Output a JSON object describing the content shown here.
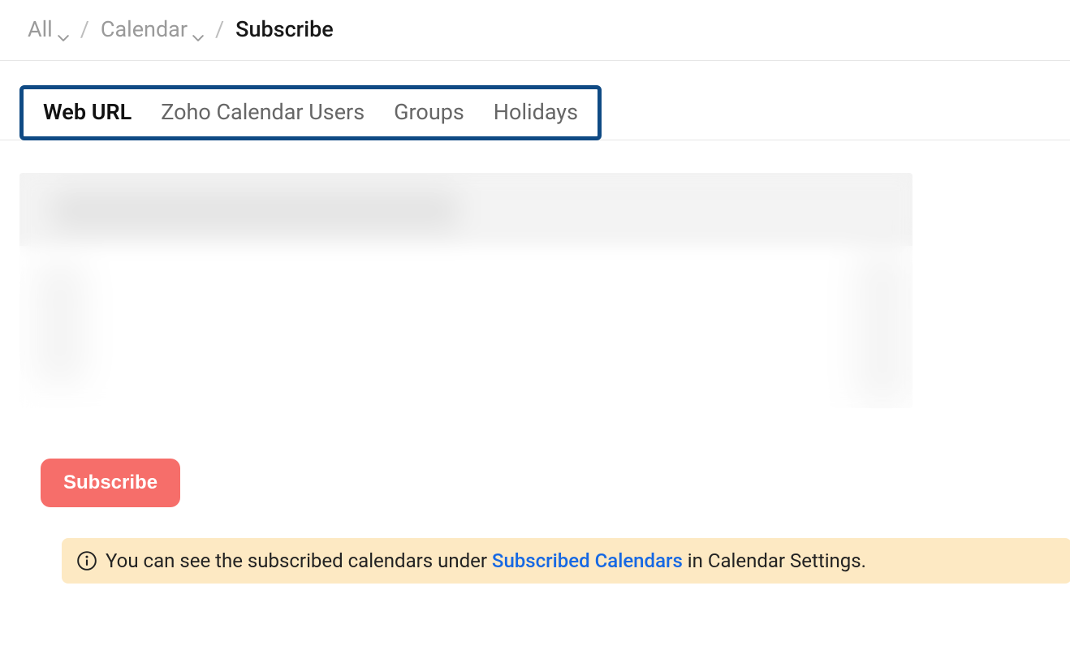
{
  "breadcrumb": {
    "items": [
      {
        "label": "All",
        "hasDropdown": true
      },
      {
        "label": "Calendar",
        "hasDropdown": true
      }
    ],
    "current": "Subscribe"
  },
  "tabs": [
    {
      "label": "Web URL",
      "active": true
    },
    {
      "label": "Zoho Calendar Users",
      "active": false
    },
    {
      "label": "Groups",
      "active": false
    },
    {
      "label": "Holidays",
      "active": false
    }
  ],
  "actions": {
    "subscribe": "Subscribe"
  },
  "info": {
    "prefix": "You can see the subscribed calendars under ",
    "link": "Subscribed Calendars",
    "suffix": " in Calendar Settings."
  }
}
